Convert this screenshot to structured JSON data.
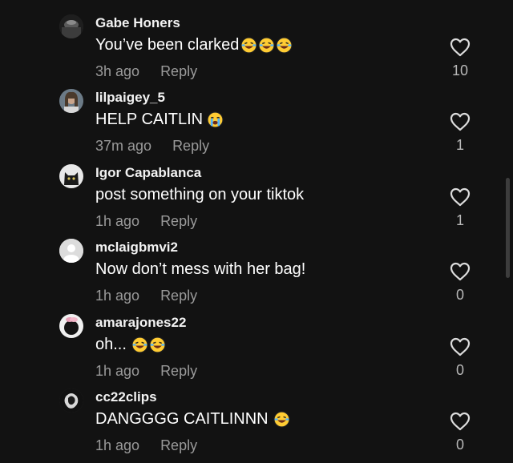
{
  "comments": [
    {
      "username": "Gabe Honers",
      "text": "You’ve been clarked",
      "emoji_count": 3,
      "time": "3h ago",
      "reply": "Reply",
      "likes": "10",
      "avatar": "dark-photo-avatar"
    },
    {
      "username": "lilpaigey_5",
      "text": "HELP CAITLIN",
      "emoji_count": 1,
      "emoji_type": "crying",
      "time": "37m ago",
      "reply": "Reply",
      "likes": "1",
      "avatar": "girl-photo-avatar"
    },
    {
      "username": "Igor Capablanca",
      "text": "post something on your tiktok",
      "emoji_count": 0,
      "time": "1h ago",
      "reply": "Reply",
      "likes": "1",
      "avatar": "cat-photo-avatar"
    },
    {
      "username": "mclaigbmvi2",
      "text": "Now don’t mess with her bag!",
      "emoji_count": 0,
      "time": "1h ago",
      "reply": "Reply",
      "likes": "0",
      "avatar": "default-avatar"
    },
    {
      "username": "amarajones22",
      "text": "oh...",
      "emoji_count": 2,
      "time": "1h ago",
      "reply": "Reply",
      "likes": "0",
      "avatar": "person-photo-avatar"
    },
    {
      "username": "cc22clips",
      "text": "DANGGGG CAITLINNN",
      "emoji_count": 1,
      "time": "1h ago",
      "reply": "Reply",
      "likes": "0",
      "avatar": "logo-avatar"
    }
  ],
  "colors": {
    "background": "#121212",
    "text": "#ffffff",
    "muted": "#9a9a9a"
  }
}
